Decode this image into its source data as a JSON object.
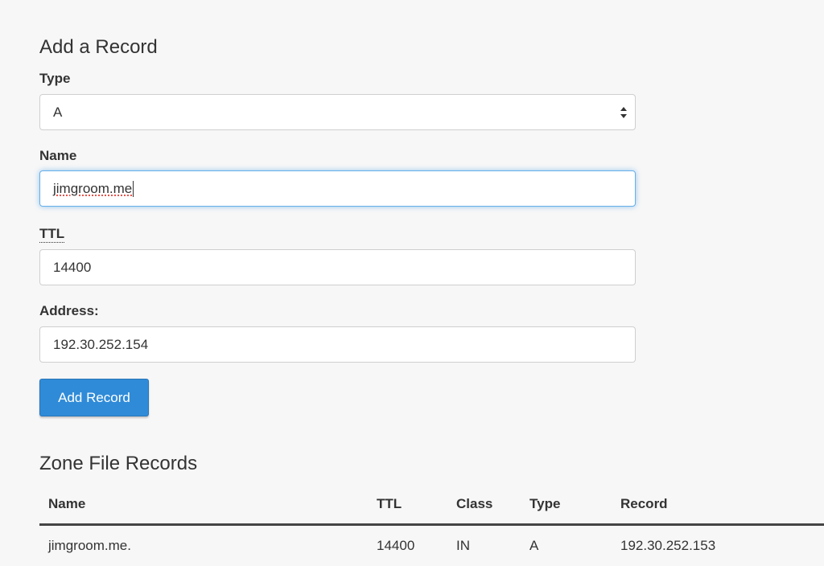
{
  "add_record": {
    "title": "Add a Record",
    "type_label": "Type",
    "type_value": "A",
    "name_label": "Name",
    "name_value": "jimgroom.me",
    "ttl_label": "TTL",
    "ttl_value": "14400",
    "address_label": "Address:",
    "address_value": "192.30.252.154",
    "submit_label": "Add Record"
  },
  "zone_records": {
    "title": "Zone File Records",
    "columns": [
      "Name",
      "TTL",
      "Class",
      "Type",
      "Record"
    ],
    "rows": [
      {
        "name": "jimgroom.me.",
        "ttl": "14400",
        "class": "IN",
        "type": "A",
        "record": "192.30.252.153"
      }
    ]
  },
  "icons": {
    "type_select_arrow": "select-arrows-icon"
  },
  "colors": {
    "button_primary": "#2f8bd8",
    "focus_ring": "#66afe9",
    "background": "#f7f7f7"
  }
}
